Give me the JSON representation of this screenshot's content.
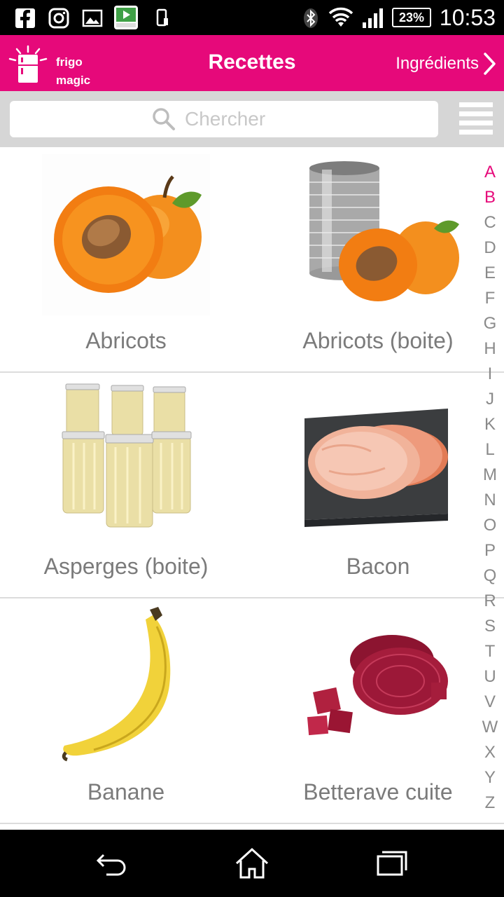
{
  "status_bar": {
    "time": "10:53",
    "battery": "23%",
    "icons": [
      "facebook-icon",
      "instagram-icon",
      "gallery-icon",
      "nikon-app-icon",
      "phone-icon",
      "bluetooth-icon",
      "wifi-icon",
      "signal-icon"
    ]
  },
  "app_bar": {
    "logo_line1": "frigo",
    "logo_line2": "magic",
    "title": "Recettes",
    "ingredients_link": "Ingrédients"
  },
  "search": {
    "placeholder": "Chercher"
  },
  "items": [
    {
      "label": "Abricots",
      "image": "apricot"
    },
    {
      "label": "Abricots (boite)",
      "image": "canned-apricot"
    },
    {
      "label": "Asperges (boite)",
      "image": "asparagus-jars"
    },
    {
      "label": "Bacon",
      "image": "bacon"
    },
    {
      "label": "Banane",
      "image": "banana"
    },
    {
      "label": "Betterave cuite",
      "image": "beetroot"
    }
  ],
  "alphabet": [
    "A",
    "B",
    "C",
    "D",
    "E",
    "F",
    "G",
    "H",
    "I",
    "J",
    "K",
    "L",
    "M",
    "N",
    "O",
    "P",
    "Q",
    "R",
    "S",
    "T",
    "U",
    "V",
    "W",
    "X",
    "Y",
    "Z"
  ],
  "alphabet_active": [
    "A",
    "B"
  ],
  "colors": {
    "accent": "#e6097a",
    "label": "#7b7b7b",
    "search_bg": "#d6d6d6"
  }
}
